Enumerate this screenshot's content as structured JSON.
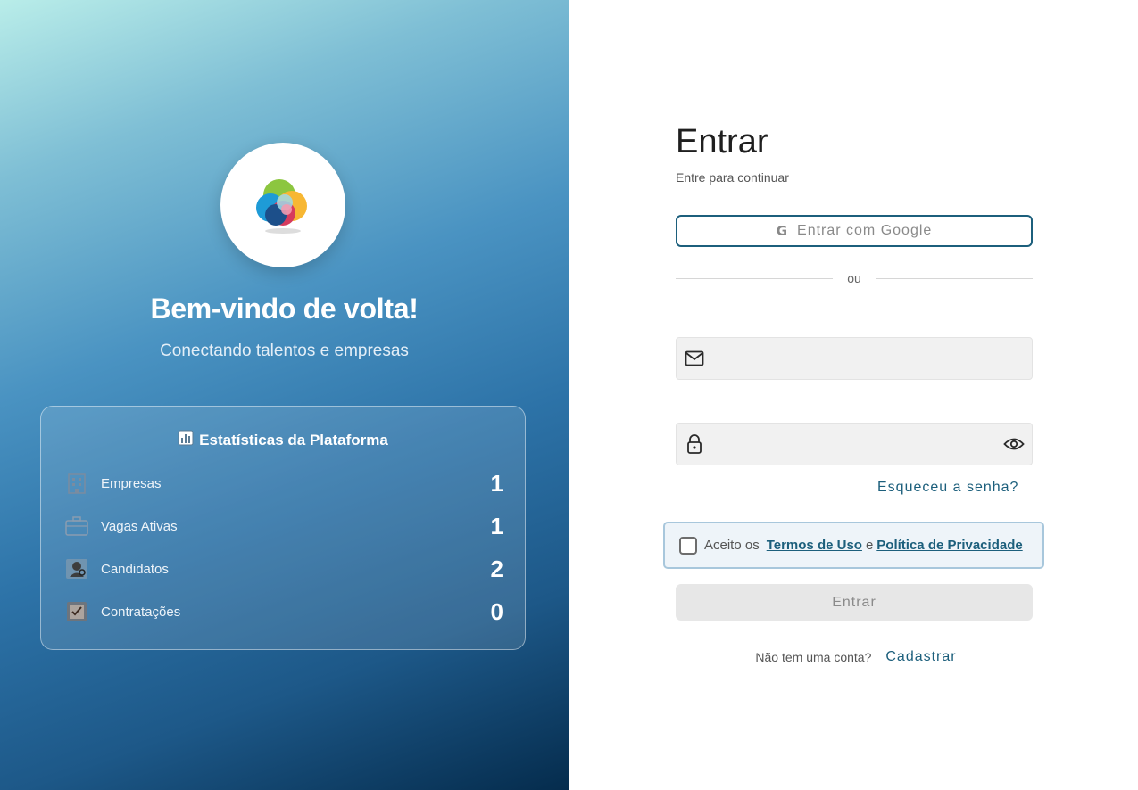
{
  "hero": {
    "welcome": "Bem-vindo de volta!",
    "tagline": "Conectando talentos e empresas"
  },
  "stats": {
    "title": "Estatísticas da Plataforma",
    "title_icon": "bar-chart-icon",
    "items": [
      {
        "label": "Empresas",
        "value": "1",
        "icon": "building-icon"
      },
      {
        "label": "Vagas Ativas",
        "value": "1",
        "icon": "briefcase-icon"
      },
      {
        "label": "Candidatos",
        "value": "2",
        "icon": "person-search-icon"
      },
      {
        "label": "Contratações",
        "value": "0",
        "icon": "checklist-icon"
      }
    ]
  },
  "login": {
    "title": "Entrar",
    "subtitle": "Entre para continuar",
    "google_button": "Entrar com Google",
    "divider": "ou",
    "email_value": "",
    "password_value": "",
    "forgot": "Esqueceu a senha?",
    "terms_prefix": "Aceito os",
    "terms_link": "Termos de Uso",
    "terms_and": "e",
    "privacy_link": "Política de Privacidade",
    "submit": "Entrar",
    "no_account": "Não tem uma conta?",
    "signup": "Cadastrar"
  },
  "colors": {
    "primary": "#1c5f7c",
    "terms_border": "#a8c7dc"
  }
}
